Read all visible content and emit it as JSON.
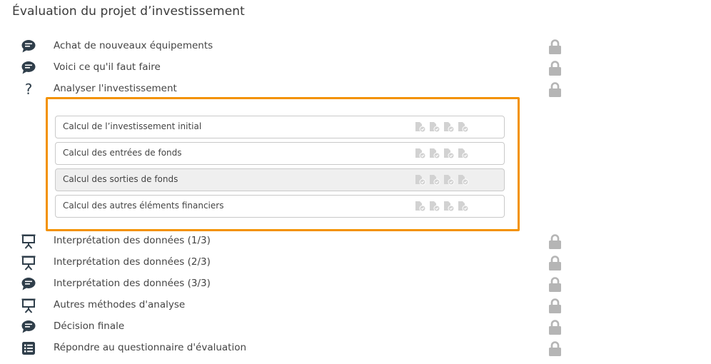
{
  "page": {
    "title": "Évaluation du projet d’investissement"
  },
  "items_top": [
    {
      "label": "Achat de nouveaux équipements",
      "icon": "chat-bubble-icon"
    },
    {
      "label": "Voici ce qu'il faut faire",
      "icon": "chat-bubble-icon"
    },
    {
      "label": "Analyser l'investissement",
      "icon": "question-mark-icon"
    }
  ],
  "subitems": [
    {
      "label": "Calcul de l’investissement initial"
    },
    {
      "label": "Calcul des entrées de fonds"
    },
    {
      "label": "Calcul des sorties de fonds"
    },
    {
      "label": "Calcul des autres éléments financiers"
    }
  ],
  "items_bottom": [
    {
      "label": "Interprétation des données (1/3)",
      "icon": "presentation-board-icon"
    },
    {
      "label": "Interprétation des données (2/3)",
      "icon": "presentation-board-icon"
    },
    {
      "label": "Interprétation des données (3/3)",
      "icon": "chat-bubble-icon"
    },
    {
      "label": "Autres méthodes d'analyse",
      "icon": "presentation-board-icon"
    },
    {
      "label": "Décision finale",
      "icon": "chat-bubble-icon"
    },
    {
      "label": "Répondre au questionnaire d'évaluation",
      "icon": "checklist-icon"
    }
  ],
  "colors": {
    "highlight": "#f39200",
    "icon": "#2f3e4a",
    "lock": "#b5b5b5",
    "doc": "#cfcfcf"
  }
}
